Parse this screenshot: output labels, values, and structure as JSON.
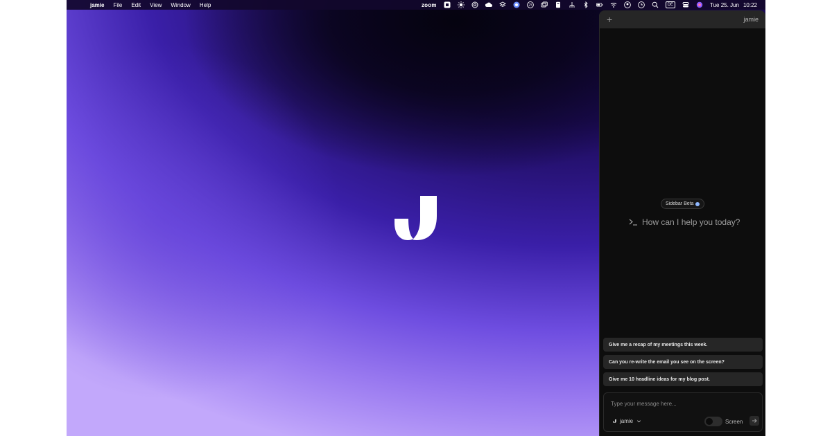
{
  "menubar": {
    "apple_glyph": "",
    "app_name": "jamie",
    "menus": [
      "File",
      "Edit",
      "View",
      "Window",
      "Help"
    ],
    "zoom_label": "zoom",
    "calendar_badge": "25",
    "keyboard_layout": "DE",
    "date": "Tue 25. Jun",
    "time": "10:22"
  },
  "sidebar": {
    "new_label": "+",
    "brand": "jamie",
    "beta_badge": "Sidebar Beta",
    "prompt": "How can I help you today?",
    "suggestions": [
      "Give me a recap of my meetings this week.",
      "Can you re-write the email you see on the screen?",
      "Give me 10 headline ideas for my blog post."
    ],
    "composer": {
      "placeholder": "Type your message here...",
      "value": "",
      "agent": "jamie",
      "screen_label": "Screen",
      "screen_enabled": false
    }
  },
  "colors": {
    "sidebar_bg": "#0d0d0d",
    "suggestion_bg": "#262626",
    "wallpaper_accent": "#6e4de0"
  }
}
